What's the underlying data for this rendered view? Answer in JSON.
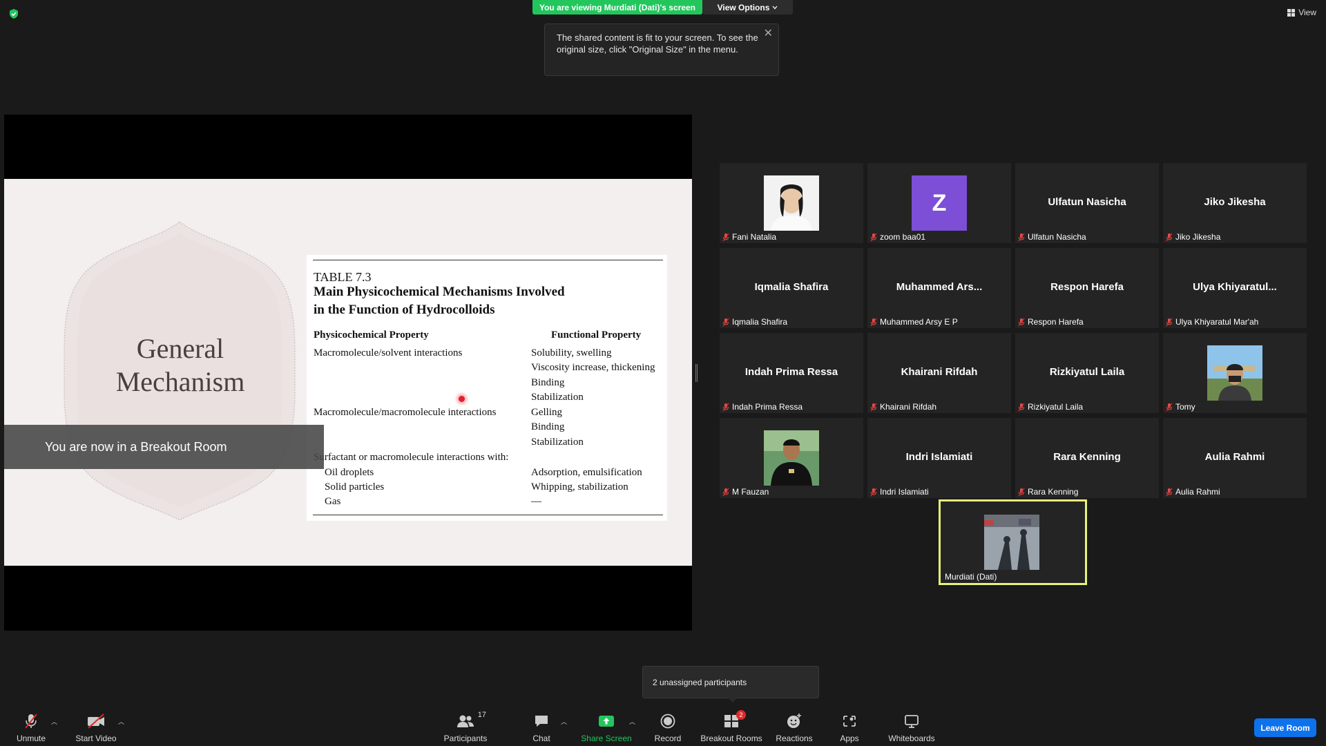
{
  "top": {
    "viewing_text": "You are viewing Murdiati (Dati)'s screen",
    "view_options_label": "View Options",
    "view_label": "View"
  },
  "tooltip": {
    "text": "The shared content is fit to your screen. To see the original size, click \"Original Size\" in the menu."
  },
  "slide": {
    "title_line1": "General",
    "title_line2": "Mechanism",
    "table": {
      "label": "TABLE 7.3",
      "caption_line1": "Main Physicochemical Mechanisms Involved",
      "caption_line2": "in the Function of Hydrocolloids",
      "col_left": "Physicochemical Property",
      "col_right": "Functional Property",
      "left_cells": [
        "Macromolecule/solvent interactions",
        "Macromolecule/macromolecule interactions",
        "Surfactant or macromolecule interactions with:",
        "Oil droplets",
        "Solid particles",
        "Gas"
      ],
      "right_cells": [
        "Solubility, swelling",
        "Viscosity increase, thickening",
        "Binding",
        "Stabilization",
        "Gelling",
        "Binding",
        "Stabilization",
        "Adsorption, emulsification",
        "Whipping, stabilization",
        "—"
      ]
    }
  },
  "banner": {
    "text": "You are now in a Breakout Room"
  },
  "participants": [
    {
      "name": "Fani Natalia",
      "display": ""
    },
    {
      "name": "zoom baa01",
      "display": "",
      "avatar_letter": "Z"
    },
    {
      "name": "Ulfatun Nasicha",
      "display": "Ulfatun Nasicha"
    },
    {
      "name": "Jiko Jikesha",
      "display": "Jiko Jikesha"
    },
    {
      "name": "Iqmalia Shafira",
      "display": "Iqmalia Shafira"
    },
    {
      "name": "Muhammed Arsy E P",
      "display": "Muhammed  Ars..."
    },
    {
      "name": "Respon Harefa",
      "display": "Respon Harefa"
    },
    {
      "name": "Ulya Khiyaratul Mar'ah",
      "display": "Ulya  Khiyaratul..."
    },
    {
      "name": "Indah Prima Ressa",
      "display": "Indah Prima Ressa"
    },
    {
      "name": "Khairani Rifdah",
      "display": "Khairani Rifdah"
    },
    {
      "name": "Rizkiyatul Laila",
      "display": "Rizkiyatul Laila"
    },
    {
      "name": "Tomy",
      "display": ""
    },
    {
      "name": "M Fauzan",
      "display": ""
    },
    {
      "name": "Indri Islamiati",
      "display": "Indri Islamiati"
    },
    {
      "name": "Rara Kenning",
      "display": "Rara Kenning"
    },
    {
      "name": "Aulia Rahmi",
      "display": "Aulia Rahmi"
    }
  ],
  "self_tile": {
    "name": "Murdiati (Dati)"
  },
  "unassigned": {
    "text": "2 unassigned participants"
  },
  "toolbar": {
    "unmute": "Unmute",
    "start_video": "Start Video",
    "participants": "Participants",
    "participants_count": "17",
    "chat": "Chat",
    "share_screen": "Share Screen",
    "record": "Record",
    "breakout_rooms": "Breakout Rooms",
    "breakout_badge": "2",
    "reactions": "Reactions",
    "apps": "Apps",
    "whiteboards": "Whiteboards",
    "leave": "Leave Room"
  },
  "colors": {
    "share_green": "#23c65d",
    "leave_blue": "#0e72ed",
    "active_speaker": "#e7f27a",
    "avatar_purple": "#7c4fd6",
    "mute_red": "#e02828"
  }
}
